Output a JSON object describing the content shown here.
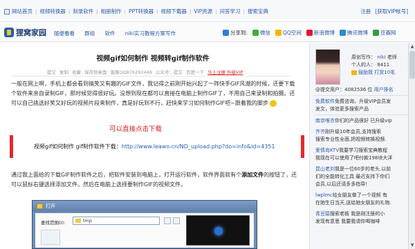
{
  "topnav": {
    "links": [
      "网站首页",
      "视频转换器",
      "刻录软件",
      "相册制作",
      "PPT转换器",
      "视频下载器",
      "VIP资源",
      "问答学习",
      "搜索宝典"
    ],
    "right": [
      "注册",
      "[获取VIP帐号]"
    ]
  },
  "header": {
    "logo": "狸窝家园",
    "nav": [
      "随便看看",
      "群组",
      "软件",
      "niki实习教程方案写作"
    ],
    "share_label": "分享到:",
    "share": [
      {
        "label": "微信",
        "color": "#3cb034"
      },
      {
        "label": "QQ空间",
        "color": "#f4b400"
      },
      {
        "label": "新浪微博",
        "color": "#e6162d"
      },
      {
        "label": "腾讯微博",
        "color": "#2a8ad4"
      },
      {
        "label": "豆瓣网",
        "color": "#2f9e3f"
      }
    ]
  },
  "article": {
    "title": "视频gif如何制作 视频转gif制作软件",
    "meta": [
      "提交",
      "复制",
      "收藏",
      "保存到桌面",
      "客服QQ876292449",
      "公众号：提交",
      "百度一下"
    ],
    "meta_link": "马上注册 升级VIP",
    "para1": "一般在网上啊，手机上都会看到搞笑又有趣的GIF文件，我记得之前刚开始兴起了一阵快手GIF风潮的时候，还要下载个软件来亲自录制GIF，那时候觉得很好玩。没想到现在都可以直接在电脑上制作GIF了，不用自己来录制和拍摄。还可以自己挑选好笑又好玩的视频片段来制作，真是好玩到不行，赶快来学习如何制作GIF吧~跟着我的脚步",
    "red_tip": "可以直接点击下载",
    "download_label": "视频gif如何制作 gif制作软件下载：",
    "download_url": "http://www.leawo.cn/ND_upload.php?do=info&id=4351",
    "para2_a": "通过我上面给的下载GIF制作软件之后，把软件安装到电脑上，打开运行软件，软件界面就有个",
    "para2_bold": "添加文件",
    "para2_b": "的按钮了，还可以鼠标右键选择添加文件。然后在电脑上选择要制作GIF的视频文件。"
  },
  "dialog": {
    "title": "打开",
    "lookin_label": "查找范围(I):",
    "folder": "tmp"
  },
  "sidebar": {
    "profile": {
      "role": "原创写作：",
      "name": "niki",
      "name_suffix": "老师",
      "people_label": "个人的人：",
      "people": "8411",
      "points": "鼓励我",
      "tip": "打赏10毛"
    },
    "stats": "@提交用户：4082536 位",
    "stats_link": "用户排名",
    "lines": [
      {
        "user": "免费软件",
        "text": "免费咨询，升级VIP会员发"
      },
      {
        "user": "",
        "text": "发文，体验更多搜索产品"
      },
      {
        "user": "南京唯衣",
        "text": "你们的产品很好 已升级vip"
      },
      {
        "user": "齐齐",
        "text": "刚升级10年会员,支持搜索"
      },
      {
        "user": "",
        "text": "搜索专业性全面,把视频转换视频."
      },
      {
        "user": "爱情岛KTV",
        "text": "我要学习搜索宝典教程"
      },
      {
        "user": "",
        "text": "我现在可以使用了吧付款198块大洋"
      },
      {
        "user": "昆山老刘",
        "text": "我是一位60岁的老头,以前"
      },
      {
        "user": "",
        "text": "们的全能转化工具 最近支持下你们"
      },
      {
        "user": "",
        "text": "会员,以后还请多多指导!"
      },
      {
        "user": "lwplmc",
        "text": "给女朋友做了一个视频 有"
      },
      {
        "user": "",
        "text": "在她生日当天,送给她女朋友的礼物."
      },
      {
        "user": "青豆猿",
        "text": "搜索老板 我是刚注册的小"
      },
      {
        "user": "",
        "text": "发现有意思 我要我请你喝咖啡"
      }
    ]
  }
}
